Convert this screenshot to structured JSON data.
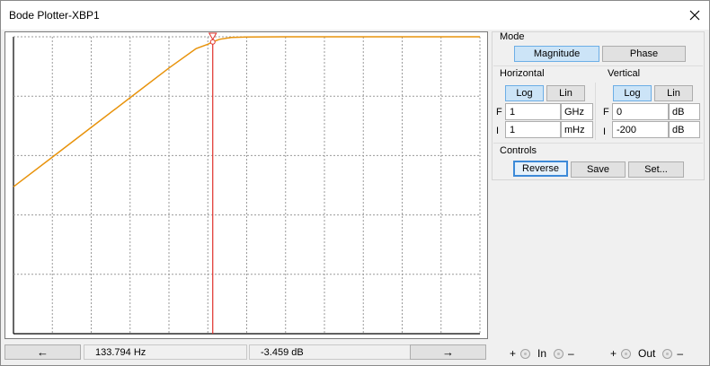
{
  "window": {
    "title": "Bode Plotter-XBP1",
    "close_icon": "close-icon"
  },
  "mode": {
    "label": "Mode",
    "magnitude": "Magnitude",
    "phase": "Phase",
    "selected": "Magnitude"
  },
  "horizontal": {
    "label": "Horizontal",
    "log": "Log",
    "lin": "Lin",
    "selected": "Log",
    "final_label": "F",
    "final_value": "1",
    "final_unit": "GHz",
    "initial_label": "I",
    "initial_value": "1",
    "initial_unit": "mHz"
  },
  "vertical": {
    "label": "Vertical",
    "log": "Log",
    "lin": "Lin",
    "selected": "Log",
    "final_label": "F",
    "final_value": "0",
    "final_unit": "dB",
    "initial_label": "I",
    "initial_value": "-200",
    "initial_unit": "dB"
  },
  "controls": {
    "label": "Controls",
    "reverse": "Reverse",
    "save": "Save",
    "set": "Set..."
  },
  "readout": {
    "left_arrow": "←",
    "right_arrow": "→",
    "frequency": "133.794 Hz",
    "magnitude": "-3.459 dB"
  },
  "terminals": {
    "in_plus": "+",
    "in_label": "In",
    "in_minus": "–",
    "out_plus": "+",
    "out_label": "Out",
    "out_minus": "–"
  },
  "colors": {
    "curve": "#e8930c",
    "cursor": "#e0302a",
    "grid": "#9a9a9a",
    "selected_button": "#cce4f7"
  },
  "chart_data": {
    "type": "line",
    "title": "",
    "xlabel": "",
    "ylabel": "",
    "x_scale": "log",
    "xlim": [
      0.001,
      1000000000
    ],
    "ylim": [
      -200,
      0
    ],
    "grid": true,
    "series": [
      {
        "x": [
          0.001,
          0.01,
          0.1,
          1,
          10,
          50,
          100,
          134,
          200,
          400,
          1000,
          10000,
          1000000,
          1000000000
        ],
        "y": [
          -101,
          -81,
          -61,
          -41,
          -21,
          -8,
          -5,
          -3.459,
          -1.7,
          -0.5,
          -0.1,
          0,
          0,
          0
        ]
      }
    ],
    "cursor": {
      "x": 133.794,
      "y": -3.459
    }
  }
}
